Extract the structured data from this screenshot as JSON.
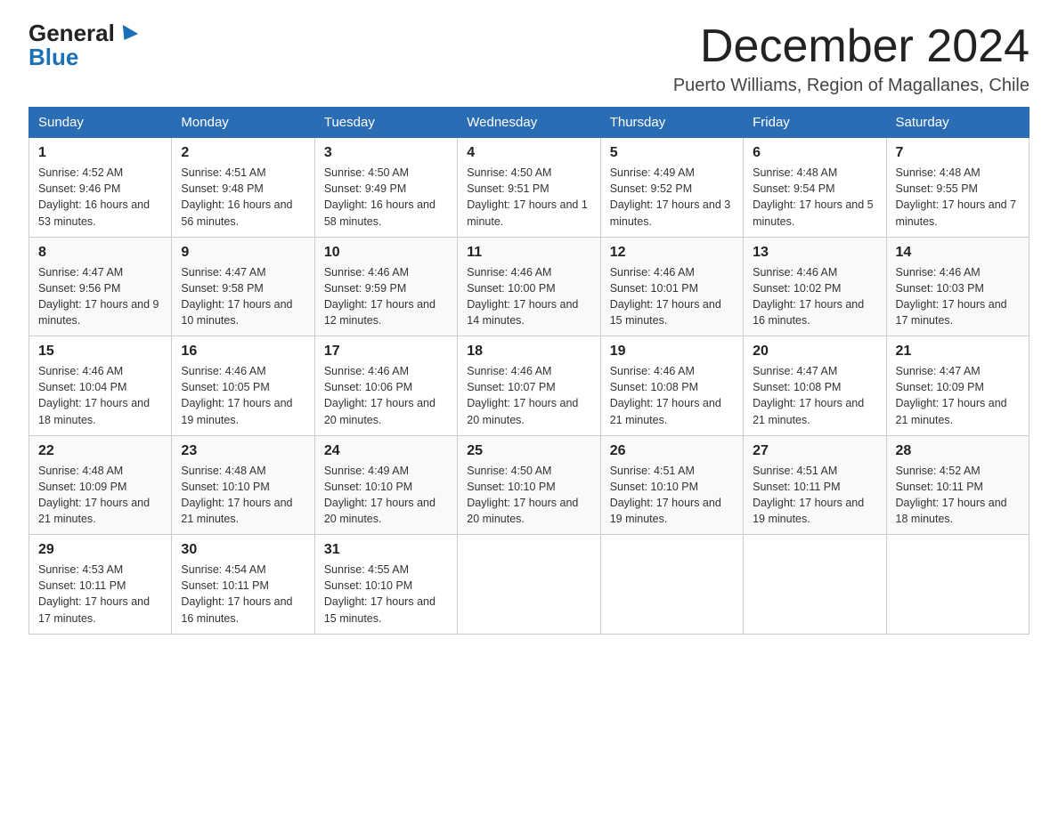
{
  "logo": {
    "general": "General",
    "blue": "Blue"
  },
  "title": "December 2024",
  "location": "Puerto Williams, Region of Magallanes, Chile",
  "weekdays": [
    "Sunday",
    "Monday",
    "Tuesday",
    "Wednesday",
    "Thursday",
    "Friday",
    "Saturday"
  ],
  "weeks": [
    [
      {
        "day": "1",
        "sunrise": "4:52 AM",
        "sunset": "9:46 PM",
        "daylight": "16 hours and 53 minutes."
      },
      {
        "day": "2",
        "sunrise": "4:51 AM",
        "sunset": "9:48 PM",
        "daylight": "16 hours and 56 minutes."
      },
      {
        "day": "3",
        "sunrise": "4:50 AM",
        "sunset": "9:49 PM",
        "daylight": "16 hours and 58 minutes."
      },
      {
        "day": "4",
        "sunrise": "4:50 AM",
        "sunset": "9:51 PM",
        "daylight": "17 hours and 1 minute."
      },
      {
        "day": "5",
        "sunrise": "4:49 AM",
        "sunset": "9:52 PM",
        "daylight": "17 hours and 3 minutes."
      },
      {
        "day": "6",
        "sunrise": "4:48 AM",
        "sunset": "9:54 PM",
        "daylight": "17 hours and 5 minutes."
      },
      {
        "day": "7",
        "sunrise": "4:48 AM",
        "sunset": "9:55 PM",
        "daylight": "17 hours and 7 minutes."
      }
    ],
    [
      {
        "day": "8",
        "sunrise": "4:47 AM",
        "sunset": "9:56 PM",
        "daylight": "17 hours and 9 minutes."
      },
      {
        "day": "9",
        "sunrise": "4:47 AM",
        "sunset": "9:58 PM",
        "daylight": "17 hours and 10 minutes."
      },
      {
        "day": "10",
        "sunrise": "4:46 AM",
        "sunset": "9:59 PM",
        "daylight": "17 hours and 12 minutes."
      },
      {
        "day": "11",
        "sunrise": "4:46 AM",
        "sunset": "10:00 PM",
        "daylight": "17 hours and 14 minutes."
      },
      {
        "day": "12",
        "sunrise": "4:46 AM",
        "sunset": "10:01 PM",
        "daylight": "17 hours and 15 minutes."
      },
      {
        "day": "13",
        "sunrise": "4:46 AM",
        "sunset": "10:02 PM",
        "daylight": "17 hours and 16 minutes."
      },
      {
        "day": "14",
        "sunrise": "4:46 AM",
        "sunset": "10:03 PM",
        "daylight": "17 hours and 17 minutes."
      }
    ],
    [
      {
        "day": "15",
        "sunrise": "4:46 AM",
        "sunset": "10:04 PM",
        "daylight": "17 hours and 18 minutes."
      },
      {
        "day": "16",
        "sunrise": "4:46 AM",
        "sunset": "10:05 PM",
        "daylight": "17 hours and 19 minutes."
      },
      {
        "day": "17",
        "sunrise": "4:46 AM",
        "sunset": "10:06 PM",
        "daylight": "17 hours and 20 minutes."
      },
      {
        "day": "18",
        "sunrise": "4:46 AM",
        "sunset": "10:07 PM",
        "daylight": "17 hours and 20 minutes."
      },
      {
        "day": "19",
        "sunrise": "4:46 AM",
        "sunset": "10:08 PM",
        "daylight": "17 hours and 21 minutes."
      },
      {
        "day": "20",
        "sunrise": "4:47 AM",
        "sunset": "10:08 PM",
        "daylight": "17 hours and 21 minutes."
      },
      {
        "day": "21",
        "sunrise": "4:47 AM",
        "sunset": "10:09 PM",
        "daylight": "17 hours and 21 minutes."
      }
    ],
    [
      {
        "day": "22",
        "sunrise": "4:48 AM",
        "sunset": "10:09 PM",
        "daylight": "17 hours and 21 minutes."
      },
      {
        "day": "23",
        "sunrise": "4:48 AM",
        "sunset": "10:10 PM",
        "daylight": "17 hours and 21 minutes."
      },
      {
        "day": "24",
        "sunrise": "4:49 AM",
        "sunset": "10:10 PM",
        "daylight": "17 hours and 20 minutes."
      },
      {
        "day": "25",
        "sunrise": "4:50 AM",
        "sunset": "10:10 PM",
        "daylight": "17 hours and 20 minutes."
      },
      {
        "day": "26",
        "sunrise": "4:51 AM",
        "sunset": "10:10 PM",
        "daylight": "17 hours and 19 minutes."
      },
      {
        "day": "27",
        "sunrise": "4:51 AM",
        "sunset": "10:11 PM",
        "daylight": "17 hours and 19 minutes."
      },
      {
        "day": "28",
        "sunrise": "4:52 AM",
        "sunset": "10:11 PM",
        "daylight": "17 hours and 18 minutes."
      }
    ],
    [
      {
        "day": "29",
        "sunrise": "4:53 AM",
        "sunset": "10:11 PM",
        "daylight": "17 hours and 17 minutes."
      },
      {
        "day": "30",
        "sunrise": "4:54 AM",
        "sunset": "10:11 PM",
        "daylight": "17 hours and 16 minutes."
      },
      {
        "day": "31",
        "sunrise": "4:55 AM",
        "sunset": "10:10 PM",
        "daylight": "17 hours and 15 minutes."
      },
      null,
      null,
      null,
      null
    ]
  ]
}
